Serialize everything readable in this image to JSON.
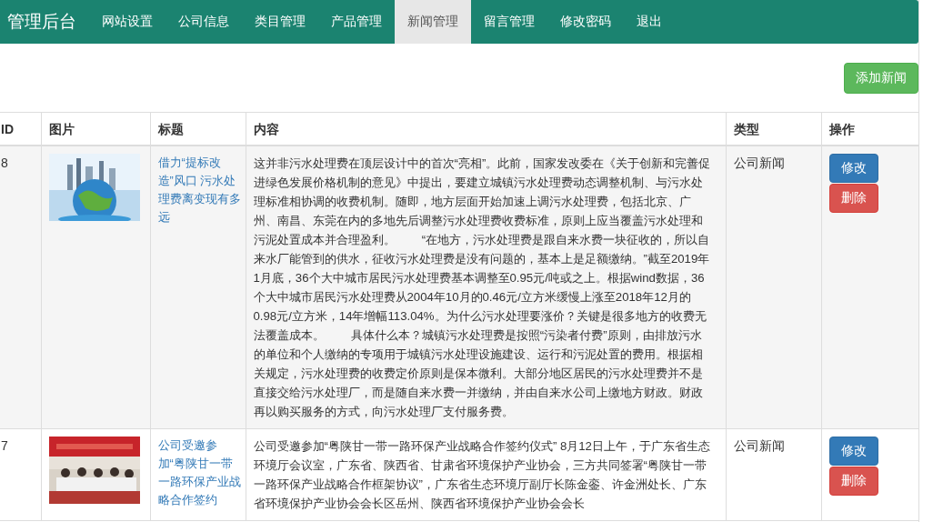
{
  "nav": {
    "brand": "管理后台",
    "items": [
      {
        "label": "网站设置",
        "selected": false
      },
      {
        "label": "公司信息",
        "selected": false
      },
      {
        "label": "类目管理",
        "selected": false
      },
      {
        "label": "产品管理",
        "selected": false
      },
      {
        "label": "新闻管理",
        "selected": true
      },
      {
        "label": "留言管理",
        "selected": false
      },
      {
        "label": "修改密码",
        "selected": false
      },
      {
        "label": "退出",
        "selected": false
      }
    ]
  },
  "add_button": "添加新闻",
  "table": {
    "columns": [
      "ID",
      "图片",
      "标题",
      "内容",
      "类型",
      "操作"
    ],
    "rows": [
      {
        "id": "8",
        "title": "借力“提标改造”风口 污水处理费离变现有多远",
        "content": "这并非污水处理费在顶层设计中的首次“亮相”。此前，国家发改委在《关于创新和完善促进绿色发展价格机制的意见》中提出，要建立城镇污水处理费动态调整机制、与污水处理标准相协调的收费机制。随即，地方层面开始加速上调污水处理费，包括北京、广州、南昌、东莞在内的多地先后调整污水处理费收费标准，原则上应当覆盖污水处理和污泥处置成本并合理盈利。        “在地方，污水处理费是跟自来水费一块征收的，所以自来水厂能管到的供水，征收污水处理费是没有问题的，基本上是足额缴纳。”截至2019年1月底，36个大中城市居民污水处理费基本调整至0.95元/吨或之上。根据wind数据，36个大中城市居民污水处理费从2004年10月的0.46元/立方米缓慢上涨至2018年12月的0.98元/立方米，14年增幅113.04%。为什么污水处理要涨价？关键是很多地方的收费无法覆盖成本。        具体什么本？城镇污水处理费是按照“污染者付费”原则，由排放污水的单位和个人缴纳的专项用于城镇污水处理设施建设、运行和污泥处置的费用。根据相关规定，污水处理费的收费定价原则是保本微利。大部分地区居民的污水处理费并不是直接交给污水处理厂，而是随自来水费一并缴纳，并由自来水公司上缴地方财政。财政再以购买服务的方式，向污水处理厂支付服务费。",
        "type": "公司新闻",
        "actions": [
          {
            "label": "修改",
            "kind": "edit"
          },
          {
            "label": "删除",
            "kind": "delete"
          }
        ]
      },
      {
        "id": "7",
        "title": "公司受邀参加“粤陕甘一带一路环保产业战略合作签约",
        "content": "公司受邀参加“粤陕甘一带一路环保产业战略合作签约仪式” 8月12日上午，于广东省生态环境厅会议室，广东省、陕西省、甘肃省环境保护产业协会，三方共同签署“粤陕甘一带一路环保产业战略合作框架协议”，广东省生态环境厅副厅长陈金銮、许金洲处长、广东省环境保护产业协会会长区岳州、陕西省环境保护产业协会会长",
        "type": "公司新闻",
        "actions": [
          {
            "label": "修改",
            "kind": "edit"
          },
          {
            "label": "删除",
            "kind": "delete"
          }
        ]
      }
    ]
  }
}
